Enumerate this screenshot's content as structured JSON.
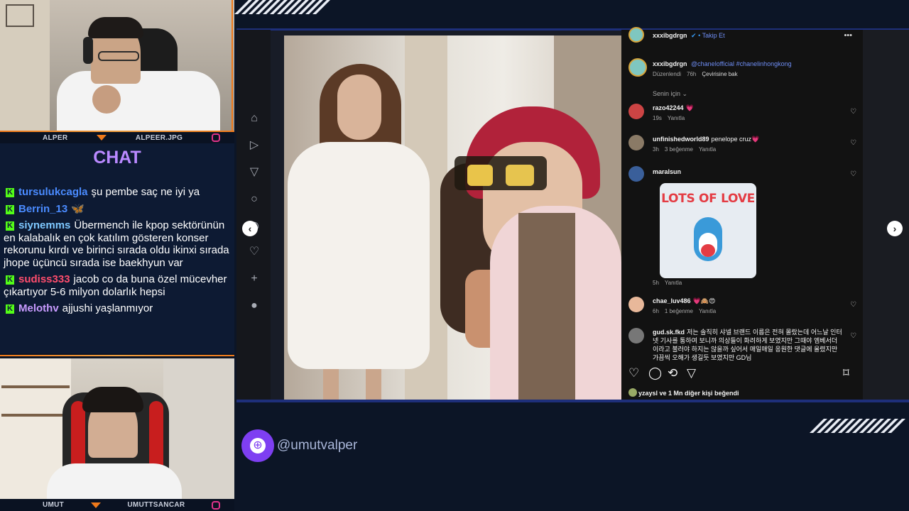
{
  "colors": {
    "accent": "#7e3ff2",
    "chat_title": "#b989ff",
    "kick_badge": "#53fc18",
    "overlay_orange": "#f07a1b",
    "link": "#6f8ef5"
  },
  "webcams": {
    "top": {
      "left_label": "ALPER",
      "right_label": "ALPEER.JPG"
    },
    "bottom": {
      "left_label": "UMUT",
      "right_label": "UMUTTSANCAR"
    }
  },
  "chat": {
    "title": "CHAT",
    "messages": [
      {
        "user": "tursulukcagla",
        "color": "#4a8bff",
        "text": "şu pembe saç ne iyi ya"
      },
      {
        "user": "Berrin_13",
        "color": "#4a8bff",
        "text": "🦋"
      },
      {
        "user": "siynemms",
        "color": "#7ec8ff",
        "text": "Übermench ile kpop sektörünün en kalabalık en çok katılım gösteren konser rekorunu kırdı ve birinci sırada oldu ikinxi sırada jhope üçüncü sırada ise baekhyun var"
      },
      {
        "user": "sudiss333",
        "color": "#ff4d6d",
        "text": "jacob co da buna özel mücevher çıkartıyor 5-6 milyon dolarlık hepsi"
      },
      {
        "user": "Melothv",
        "color": "#c89bff",
        "text": "ajjushi yaşlanmıyor"
      }
    ]
  },
  "instagram": {
    "sidebar_icons": [
      "home-icon",
      "reels-icon",
      "direct-icon",
      "search-icon",
      "explore-icon",
      "heart-icon",
      "create-icon",
      "profile-icon"
    ],
    "post_header": {
      "user": "xxxibgdrgn",
      "follow_label": "Takip Et",
      "more": "•••"
    },
    "caption": {
      "user": "xxxibgdrgn",
      "mention": "@chanelofficial",
      "hashtag": "#chanelinhongkong",
      "edited": "Düzenlendi",
      "age": "76h",
      "translate": "Çevirisine bak"
    },
    "sort_label": "Senin için",
    "comments": [
      {
        "user": "razo42244",
        "text": "💗",
        "age": "19s",
        "likes": "",
        "reply": "Yanıtla",
        "avatar": "#c44"
      },
      {
        "user": "unfinishedworld89",
        "text": "penelope cruz💗",
        "age": "3h",
        "likes": "3 beğenme",
        "reply": "Yanıtla",
        "avatar": "#8a7a66"
      },
      {
        "user": "maralsun",
        "text": "",
        "age": "5h",
        "likes": "",
        "reply": "Yanıtla",
        "avatar": "#3a5f9a",
        "sticker": "LOTS OF LOVE"
      },
      {
        "user": "chae_luv486",
        "text": "💗🙈😍",
        "age": "6h",
        "likes": "1 beğenme",
        "reply": "Yanıtla",
        "avatar": "#e8b89a"
      },
      {
        "user": "gud.sk.fkd",
        "text": "저는 솔직히 샤넬 브랜드 이름은 전혀 몰랐는데 어느날 인터넷 기사를 통하여 보니까 의상들이 화려하게 보였지만 그때야 엠베서더 이라고 불러야 하지는 않을까 싶어서 매일매일 응원한 댓글에 올렸지만 가끔씩 오해가 생길듯 보였지만 GD님",
        "age": "",
        "likes": "",
        "reply": "",
        "avatar": "#777"
      }
    ],
    "likes_summary": "yzaysl ve 1 Mn diğer kişi beğendi"
  },
  "stream_handle": "@umutvalper"
}
